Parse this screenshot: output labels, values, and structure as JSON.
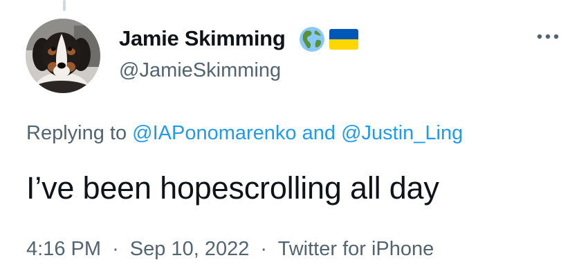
{
  "tweet": {
    "author": {
      "display_name": "Jamie Skimming",
      "handle": "@JamieSkimming",
      "name_emojis": [
        "earth-americas-icon",
        "ukraine-flag-icon"
      ]
    },
    "replying_to": {
      "prefix": "Replying to",
      "mentions": [
        "@IAPonomarenko",
        "@Justin_Ling"
      ],
      "conjunction": "and"
    },
    "text": "I’ve been hopescrolling all day",
    "meta": {
      "time": "4:16 PM",
      "date": "Sep 10, 2022",
      "source": "Twitter for iPhone",
      "separator": "·"
    },
    "more_menu_icon": "more-horizontal-icon"
  },
  "colors": {
    "text_primary": "#0f1419",
    "text_secondary": "#536471",
    "link": "#1d9bf0",
    "flag_blue": "#0057b7",
    "flag_yellow": "#ffd700"
  }
}
